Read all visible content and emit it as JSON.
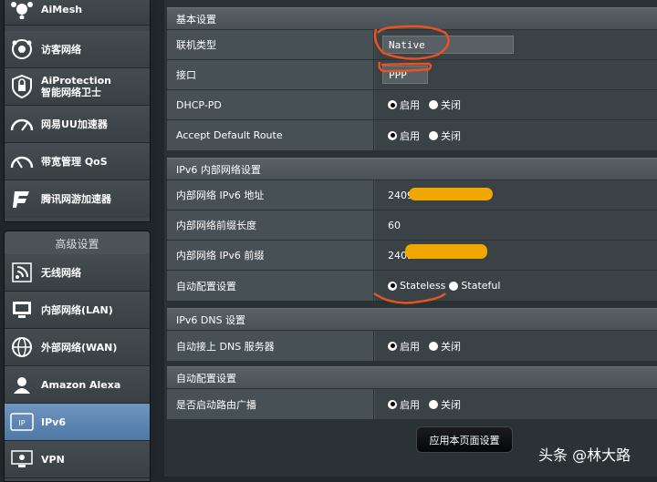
{
  "sidebar": {
    "top_items": [
      {
        "label": "AiMesh",
        "icon": "mesh-icon"
      },
      {
        "label": "访客网络",
        "icon": "guest-network-icon"
      },
      {
        "label": "AiProtection",
        "label2": "智能网络卫士",
        "icon": "shield-icon"
      },
      {
        "label": "网易UU加速器",
        "icon": "gauge-icon"
      },
      {
        "label": "带宽管理 QoS",
        "icon": "speedometer-icon"
      },
      {
        "label": "腾讯网游加速器",
        "icon": "game-accelerator-icon"
      }
    ],
    "advanced_header": "高级设置",
    "advanced_items": [
      {
        "label": "无线网络",
        "icon": "wireless-icon"
      },
      {
        "label": "内部网络(LAN)",
        "icon": "lan-icon"
      },
      {
        "label": "外部网络(WAN)",
        "icon": "globe-icon"
      },
      {
        "label": "Amazon Alexa",
        "icon": "alexa-icon"
      },
      {
        "label": "IPv6",
        "icon": "ipv6-icon",
        "active": true
      },
      {
        "label": "VPN",
        "icon": "vpn-icon"
      }
    ]
  },
  "sections": {
    "basic": {
      "title": "基本设置",
      "connection_type": {
        "label": "联机类型",
        "value": "Native"
      },
      "interface": {
        "label": "接口",
        "value": "PPP"
      },
      "dhcp_pd": {
        "label": "DHCP-PD",
        "on": "启用",
        "off": "关闭"
      },
      "default_route": {
        "label": "Accept Default Route",
        "on": "启用",
        "off": "关闭"
      }
    },
    "lan": {
      "title": "IPv6 内部网络设置",
      "address": {
        "label": "内部网络 IPv6 地址",
        "value": "2409"
      },
      "prefix_len": {
        "label": "内部网络前缀长度",
        "value": "60"
      },
      "prefix": {
        "label": "内部网络 IPv6 前缀",
        "value": "2409"
      },
      "autoconf": {
        "label": "自动配置设置",
        "opt1": "Stateless",
        "opt2": "Stateful"
      }
    },
    "dns": {
      "title": "IPv6 DNS 设置",
      "auto_dns": {
        "label": "自动接上 DNS 服务器",
        "on": "启用",
        "off": "关闭"
      }
    },
    "auto": {
      "title": "自动配置设置",
      "router_adv": {
        "label": "是否启动路由广播",
        "on": "启用",
        "off": "关闭"
      }
    }
  },
  "apply_button": "应用本页面设置",
  "watermark": "头条 @林大路",
  "colors": {
    "annotation": "#e8541f",
    "redaction": "#f0a800",
    "active": "#5a82ae"
  }
}
